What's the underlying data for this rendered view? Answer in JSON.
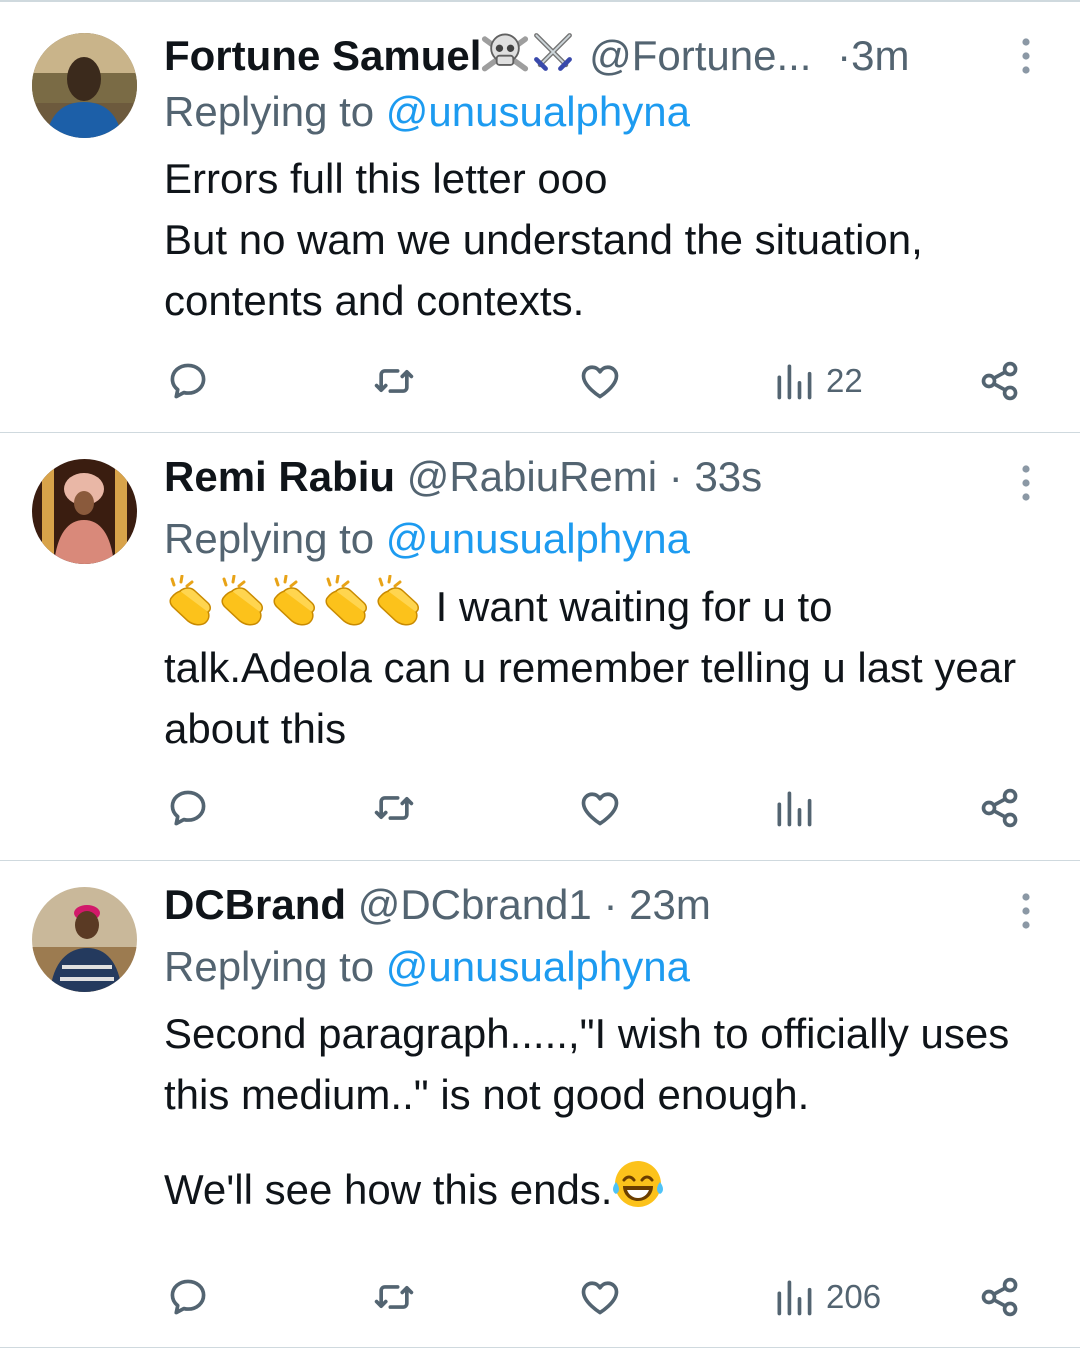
{
  "tweets": [
    {
      "name": "Fortune Samuel",
      "handle": "@Fortune...",
      "separator": "·",
      "time": "3m",
      "replying_prefix": "Replying to",
      "replying_to": "@unusualphyna",
      "lines": [
        "Errors full this letter ooo",
        "But no wam we understand the situation, contents and contexts."
      ],
      "views": "22"
    },
    {
      "name": "Remi Rabiu",
      "handle": "@RabiuRemi",
      "separator": "·",
      "time": "33s",
      "replying_prefix": "Replying to",
      "replying_to": "@unusualphyna",
      "text": "I want waiting for u to talk.Adeola can u remember telling u last year about this",
      "views": ""
    },
    {
      "name": "DCBrand",
      "handle": "@DCbrand1",
      "separator": "·",
      "time": "23m",
      "replying_prefix": "Replying to",
      "replying_to": "@unusualphyna",
      "paragraph1": "Second paragraph.....,\"I wish to officially uses this medium..\" is not good enough.",
      "paragraph2": "We'll see how this ends.",
      "views": "206"
    }
  ],
  "colors": {
    "text": "#0f1419",
    "muted": "#536471",
    "link": "#1d9bf0",
    "divider": "#cfd9de"
  },
  "icons": {
    "reply": "reply-icon",
    "retweet": "retweet-icon",
    "like": "heart-icon",
    "views": "views-chart-icon",
    "share": "share-icon",
    "more": "more-vertical-icon",
    "clap": "clapping-hands-emoji",
    "laugh": "tears-of-joy-emoji",
    "skull": "skull-crossbones-emoji",
    "swords": "crossed-swords-emoji"
  }
}
